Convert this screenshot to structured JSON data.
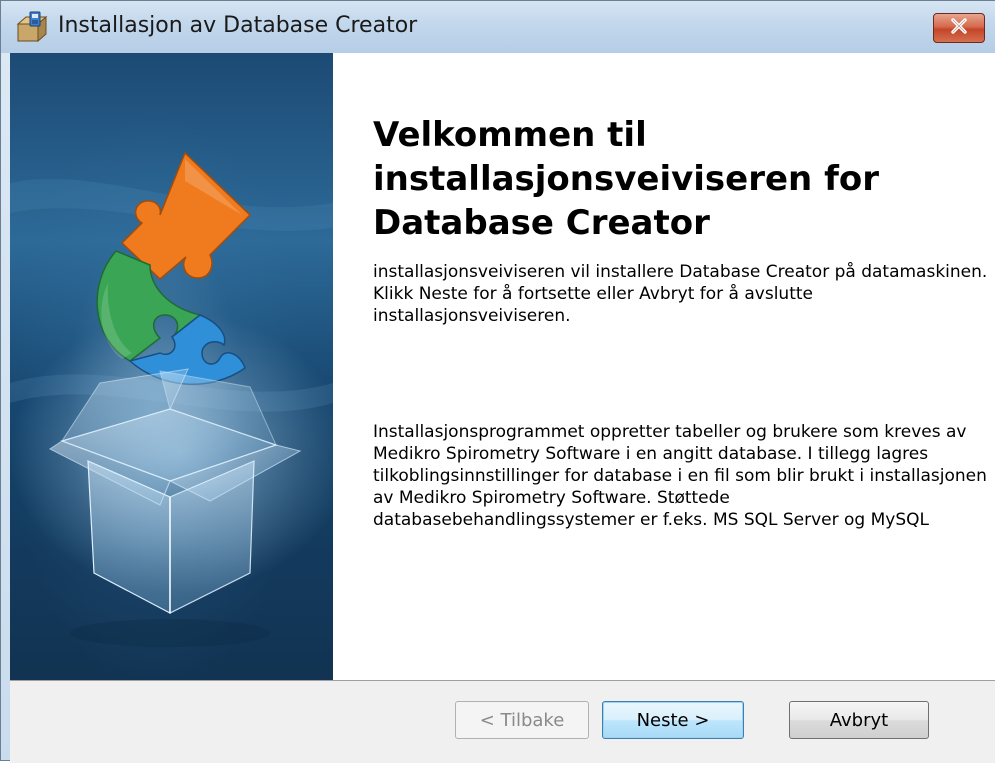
{
  "window": {
    "title": "Installasjon av Database Creator",
    "close_symbol": "×"
  },
  "welcome": {
    "heading": "Velkommen til installasjonsveiviseren for Database Creator",
    "intro": "installasjonsveiviseren vil installere Database Creator på datamaskinen.  Klikk Neste for å fortsette eller Avbryt for å avslutte installasjonsveiviseren.",
    "description": "Installasjonsprogrammet oppretter tabeller og brukere som kreves av Medikro Spirometry Software i en angitt database. I tillegg lagres tilkoblingsinnstillinger for database i en fil som blir brukt i installasjonen av Medikro Spirometry Software. Støttede databasebehandlingssystemer er f.eks. MS SQL Server og MySQL"
  },
  "buttons": {
    "back": "< Tilbake",
    "next": "Neste >",
    "cancel": "Avbryt"
  },
  "icons": {
    "title_icon": "installer-box-icon",
    "close_icon": "close-icon",
    "banner": "puzzle-box-illustration"
  },
  "colors": {
    "banner_background": "#1c4a74",
    "puzzle_orange": "#f07a1e",
    "puzzle_green": "#3aa655",
    "puzzle_blue": "#2f8fd8",
    "close_red": "#c4452a",
    "default_button_border": "#3c7fb1"
  }
}
